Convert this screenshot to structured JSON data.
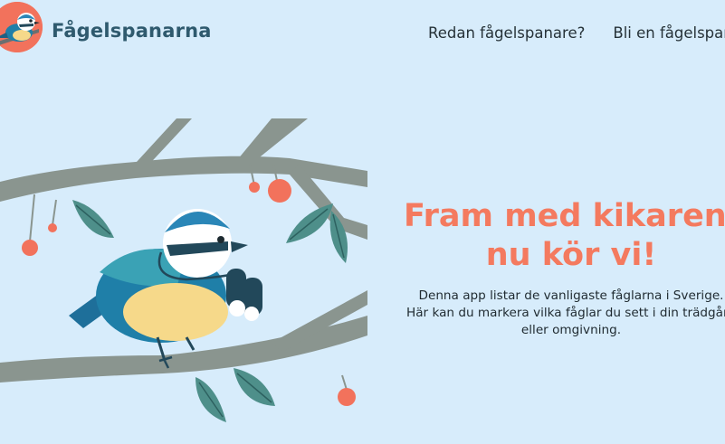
{
  "header": {
    "brand_name": "Fågelspanarna",
    "logo_icon": "blue-tit-bird-icon",
    "nav": [
      {
        "label": "Redan fågelspanare?"
      },
      {
        "label": "Bli en fågelspanare"
      }
    ]
  },
  "hero": {
    "title_line1": "Fram med kikaren,",
    "title_line2": "nu kör vi!",
    "description_lines": [
      "Denna app listar de vanligaste fåglarna i Sverige.",
      "Här kan du markera vilka fåglar du sett i din trädgård",
      "eller omgivning."
    ],
    "illustration": "blue-tit-with-binoculars-on-branch"
  },
  "colors": {
    "background": "#d7ecfb",
    "accent": "#f47a5f",
    "brand": "#2f5a6e",
    "branch": "#8a958f",
    "leaf": "#4e8f8a",
    "berry": "#f2725c"
  }
}
